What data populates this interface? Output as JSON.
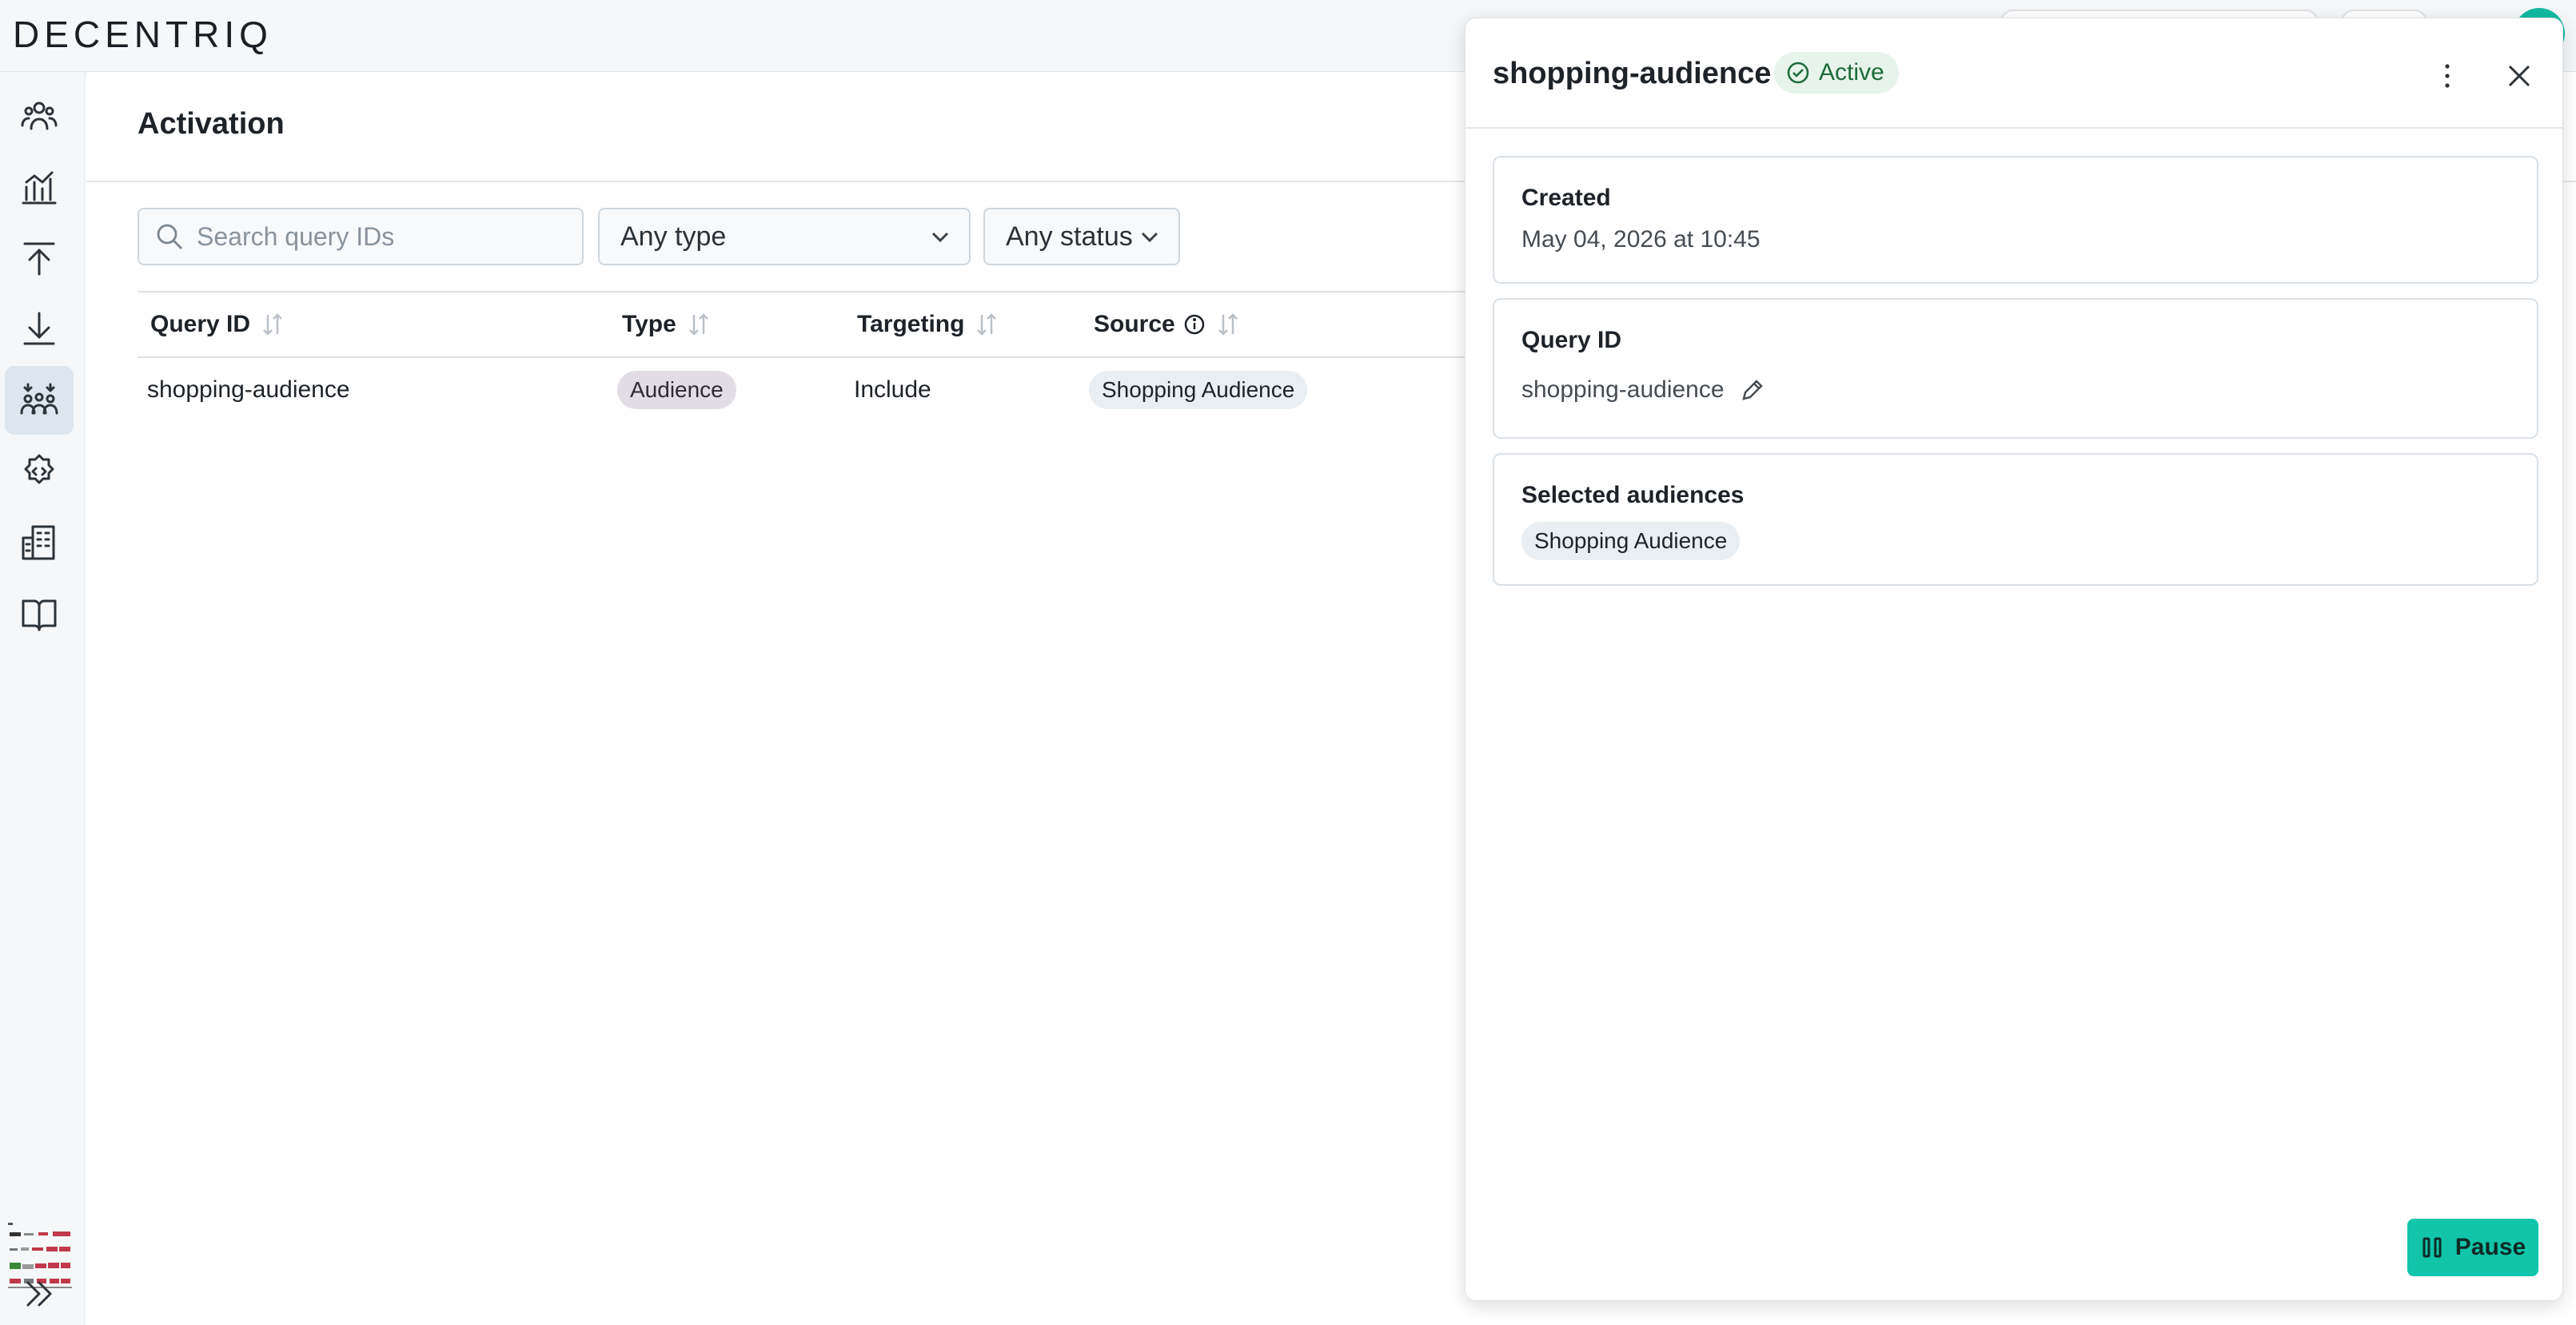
{
  "app": {
    "logo_text": "DECENTRIQ",
    "accent_color": "#11c4aa"
  },
  "sidebar": {
    "items": [
      {
        "icon": "audiences-icon"
      },
      {
        "icon": "insights-chart-icon"
      },
      {
        "icon": "upload-icon"
      },
      {
        "icon": "download-icon"
      },
      {
        "icon": "activation-icon",
        "active": true
      },
      {
        "icon": "developer-settings-icon"
      },
      {
        "icon": "organization-building-icon"
      },
      {
        "icon": "documentation-book-icon"
      }
    ],
    "expand_icon": "chevrons-right-icon"
  },
  "main": {
    "title": "Activation",
    "search": {
      "placeholder": "Search query IDs",
      "value": ""
    },
    "filters": {
      "type": "Any type",
      "status": "Any status"
    },
    "table": {
      "columns": [
        "Query ID",
        "Type",
        "Targeting",
        "Source"
      ],
      "rows": [
        {
          "query_id": "shopping-audience",
          "type": "Audience",
          "targeting": "Include",
          "source": "Shopping Audience"
        }
      ]
    }
  },
  "drawer": {
    "title": "shopping-audience",
    "status": "Active",
    "status_color": "#1d6b3a",
    "created": {
      "label": "Created",
      "value": "May 04, 2026 at 10:45"
    },
    "query_id": {
      "label": "Query ID",
      "value": "shopping-audience"
    },
    "selected_audiences": {
      "label": "Selected audiences",
      "items": [
        "Shopping Audience"
      ]
    },
    "pause_label": "Pause"
  }
}
